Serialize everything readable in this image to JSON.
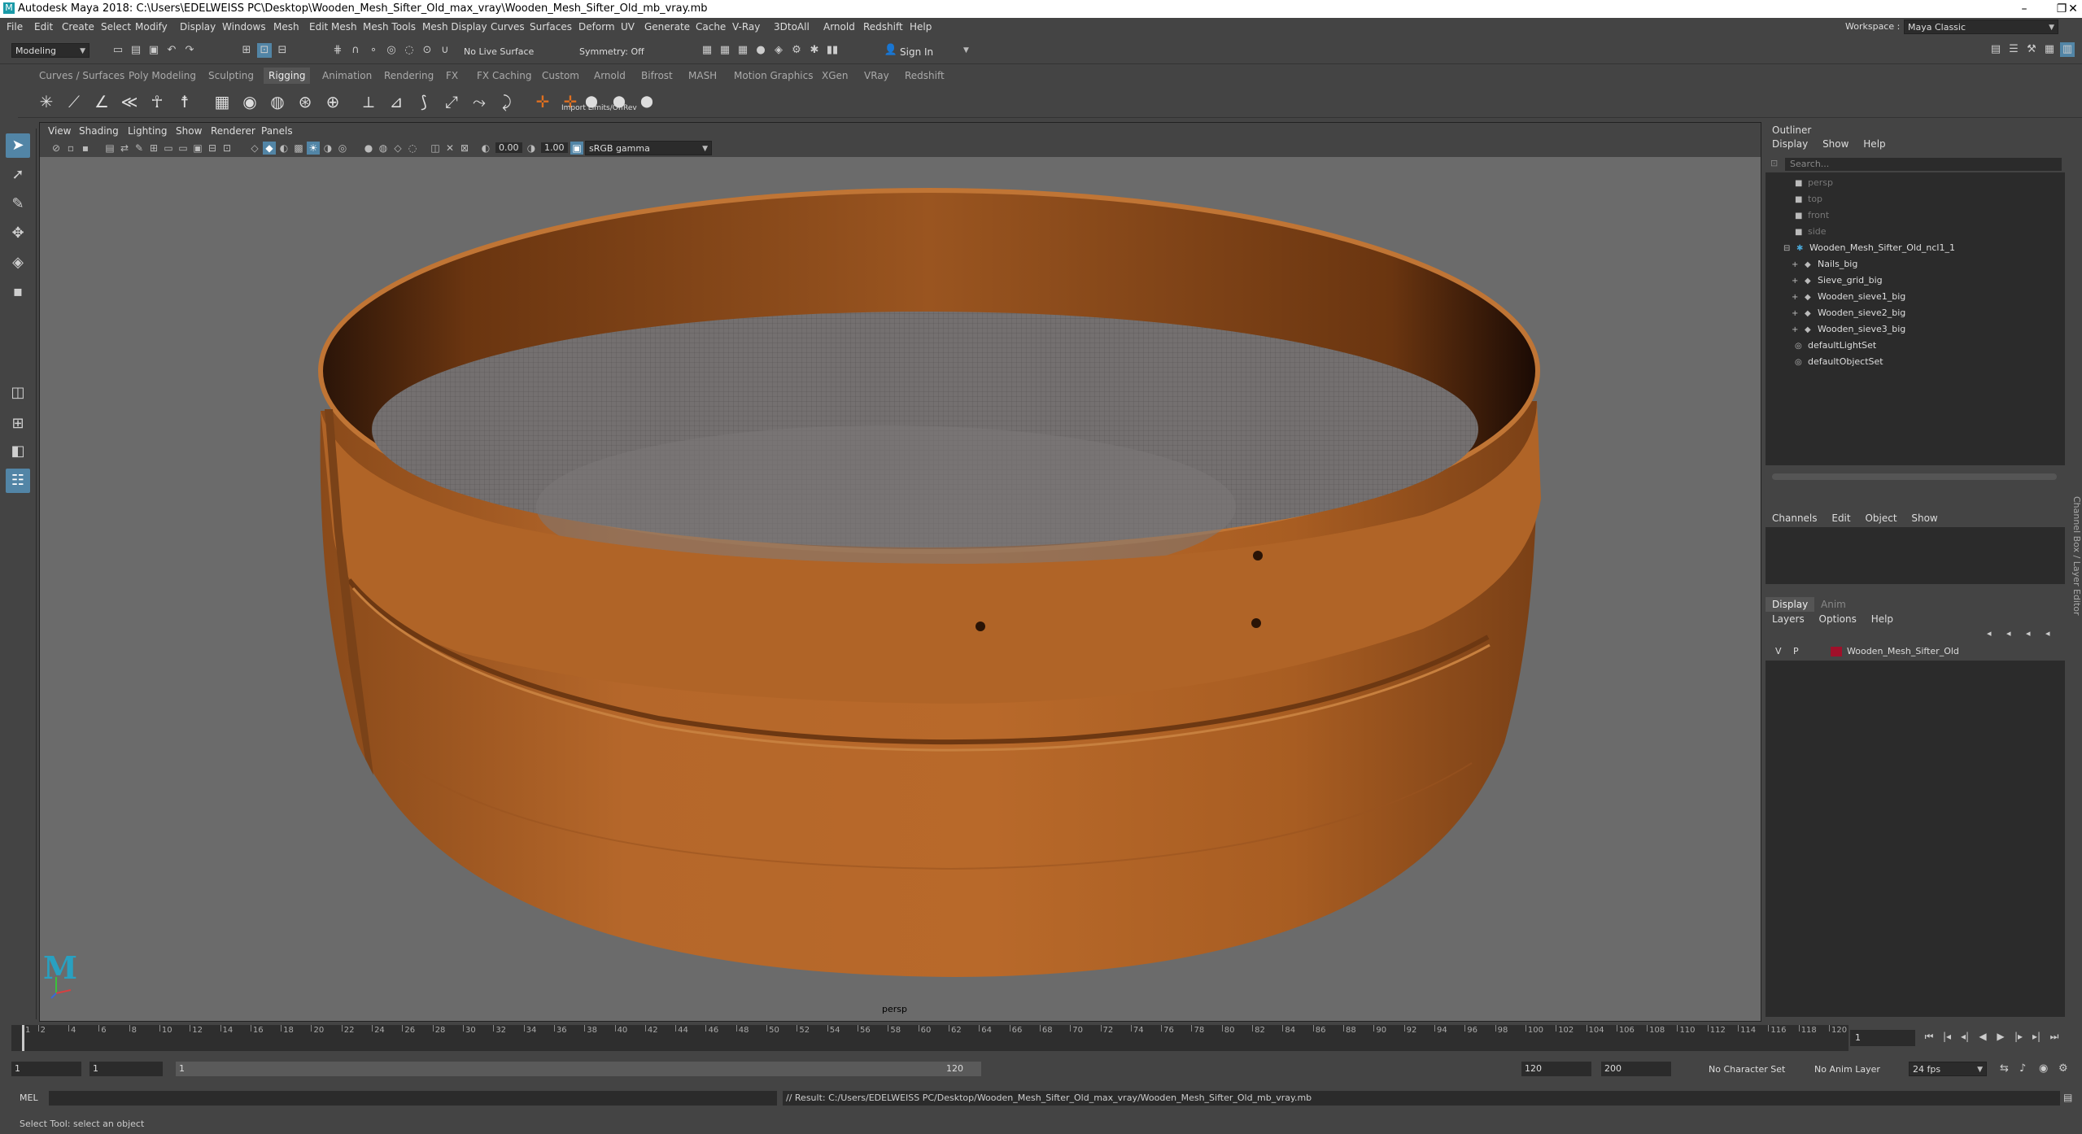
{
  "titlebar": {
    "title": "Autodesk Maya 2018: C:\\Users\\EDELWEISS PC\\Desktop\\Wooden_Mesh_Sifter_Old_max_vray\\Wooden_Mesh_Sifter_Old_mb_vray.mb",
    "minimize": "–",
    "maximize": "❐",
    "close": "✕"
  },
  "menubar": {
    "items": [
      "File",
      "Edit",
      "Create",
      "Select",
      "Modify",
      "Display",
      "Windows",
      "Mesh",
      "Edit Mesh",
      "Mesh Tools",
      "Mesh Display",
      "Curves",
      "Surfaces",
      "Deform",
      "UV",
      "Generate",
      "Cache",
      "V-Ray",
      "3DtoAll",
      "Arnold",
      "Redshift",
      "Help"
    ],
    "workspace_label": "Workspace :",
    "workspace_value": "Maya Classic"
  },
  "statusline": {
    "mode": "Modeling",
    "live_surface": "No Live Surface",
    "symmetry": "Symmetry: Off",
    "sign_in": "Sign In"
  },
  "shelf": {
    "tabs": [
      "Curves / Surfaces",
      "Poly Modeling",
      "Sculpting",
      "Rigging",
      "Animation",
      "Rendering",
      "FX",
      "FX Caching",
      "Custom",
      "Arnold",
      "Bifrost",
      "MASH",
      "Motion Graphics",
      "XGen",
      "VRay",
      "Redshift"
    ],
    "active_tab": "Rigging",
    "tooltip": "Import Limits/OffRev"
  },
  "viewport": {
    "menu": [
      "View",
      "Shading",
      "Lighting",
      "Show",
      "Renderer",
      "Panels"
    ],
    "exposure": "0.00",
    "gamma": "1.00",
    "color_space": "sRGB gamma",
    "camera_label": "persp"
  },
  "outliner": {
    "title": "Outliner",
    "menu": [
      "Display",
      "Show",
      "Help"
    ],
    "search_placeholder": "Search...",
    "cameras": [
      "persp",
      "top",
      "front",
      "side"
    ],
    "group": "Wooden_Mesh_Sifter_Old_ncl1_1",
    "children": [
      "Nails_big",
      "Sieve_grid_big",
      "Wooden_sieve1_big",
      "Wooden_sieve2_big",
      "Wooden_sieve3_big"
    ],
    "sets": [
      "defaultLightSet",
      "defaultObjectSet"
    ]
  },
  "channelbox": {
    "menu": [
      "Channels",
      "Edit",
      "Object",
      "Show"
    ]
  },
  "layers": {
    "tabs": [
      "Display",
      "Anim"
    ],
    "menu": [
      "Layers",
      "Options",
      "Help"
    ],
    "layer": {
      "v": "V",
      "p": "P",
      "name": "Wooden_Mesh_Sifter_Old",
      "color": "#a0102a"
    }
  },
  "sidetab": {
    "label": "Channel Box / Layer Editor"
  },
  "timeline": {
    "ticks": [
      "1",
      "2",
      "4",
      "6",
      "8",
      "10",
      "12",
      "14",
      "16",
      "18",
      "20",
      "22",
      "24",
      "26",
      "28",
      "30",
      "32",
      "34",
      "36",
      "38",
      "40",
      "42",
      "44",
      "46",
      "48",
      "50",
      "52",
      "54",
      "56",
      "58",
      "60",
      "62",
      "64",
      "66",
      "68",
      "70",
      "72",
      "74",
      "76",
      "78",
      "80",
      "82",
      "84",
      "86",
      "88",
      "90",
      "92",
      "94",
      "96",
      "98",
      "100",
      "102",
      "104",
      "106",
      "108",
      "110",
      "112",
      "114",
      "116",
      "118",
      "120"
    ],
    "current_frame": "1"
  },
  "range": {
    "start": "1",
    "playback_start": "1",
    "slider_start": "1",
    "slider_end": "120",
    "playback_end": "120",
    "end": "200",
    "character_set": "No Character Set",
    "anim_layer": "No Anim Layer",
    "fps": "24 fps"
  },
  "cmdline": {
    "lang": "MEL",
    "result": "// Result: C:/Users/EDELWEISS PC/Desktop/Wooden_Mesh_Sifter_Old_max_vray/Wooden_Mesh_Sifter_Old_mb_vray.mb"
  },
  "helpline": {
    "text": "Select Tool: select an object"
  },
  "colors": {
    "accent": "#5285a6",
    "wood": "#b8692a",
    "viewport_bg": "#6b6b6b"
  }
}
